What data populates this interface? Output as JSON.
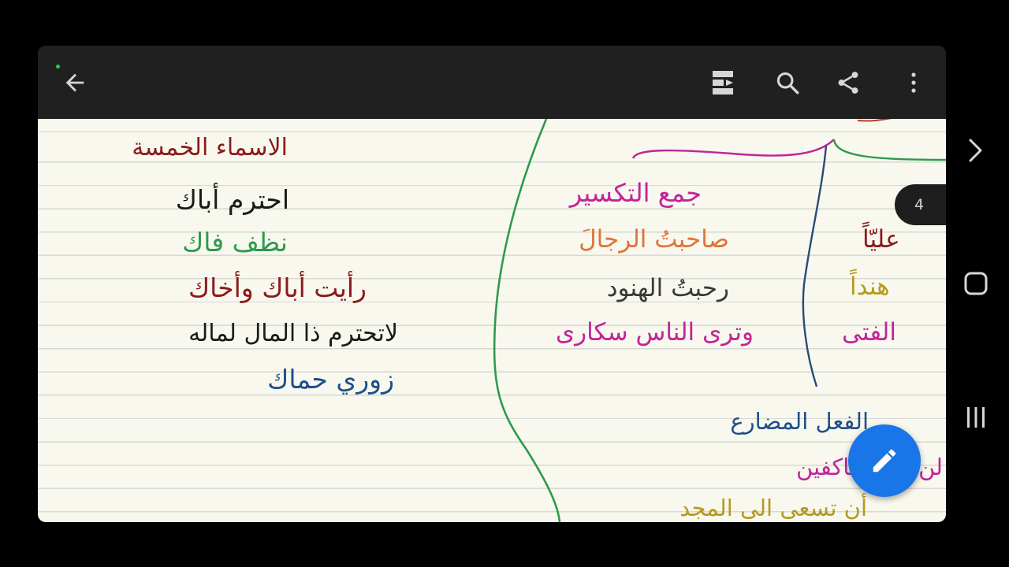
{
  "toolbar": {
    "back_icon": "arrow-back-icon",
    "icons": [
      "page-layout-icon",
      "search-icon",
      "share-icon",
      "more-vert-icon"
    ]
  },
  "page_indicator": "4",
  "notes": {
    "left_column": {
      "title": "الاسماء الخمسة",
      "lines": [
        "احترم أباك",
        "نظف فاك",
        "رأيت أباك وأخاك",
        "لاتحترم ذا المال لماله",
        "زوري حماك"
      ]
    },
    "middle_column": {
      "title": "جمع التكسير",
      "lines": [
        "صاحبتُ الرجالَ",
        "رحبتُ الهنود",
        "وترى الناس سكارى"
      ]
    },
    "right_column": {
      "lines": [
        "عليّاً",
        "هنداً",
        "الفتى"
      ]
    },
    "bottom_section": {
      "title": "الفعل المضارع",
      "lines": [
        "لن عليه عاكفين",
        "أن تسعى الى المجد"
      ]
    }
  },
  "colors": {
    "toolbar_bg": "#202020",
    "paper_bg": "#f8f8ee",
    "fab_bg": "#1976e8",
    "ink_darkred": "#8b1a1a",
    "ink_black": "#1a1a1a",
    "ink_green": "#2e9a4e",
    "ink_blue": "#1f4f8a",
    "ink_magenta": "#c2249a",
    "ink_orange": "#e07438",
    "ink_olive": "#b49a1e",
    "ink_gray": "#3a3a3a"
  }
}
